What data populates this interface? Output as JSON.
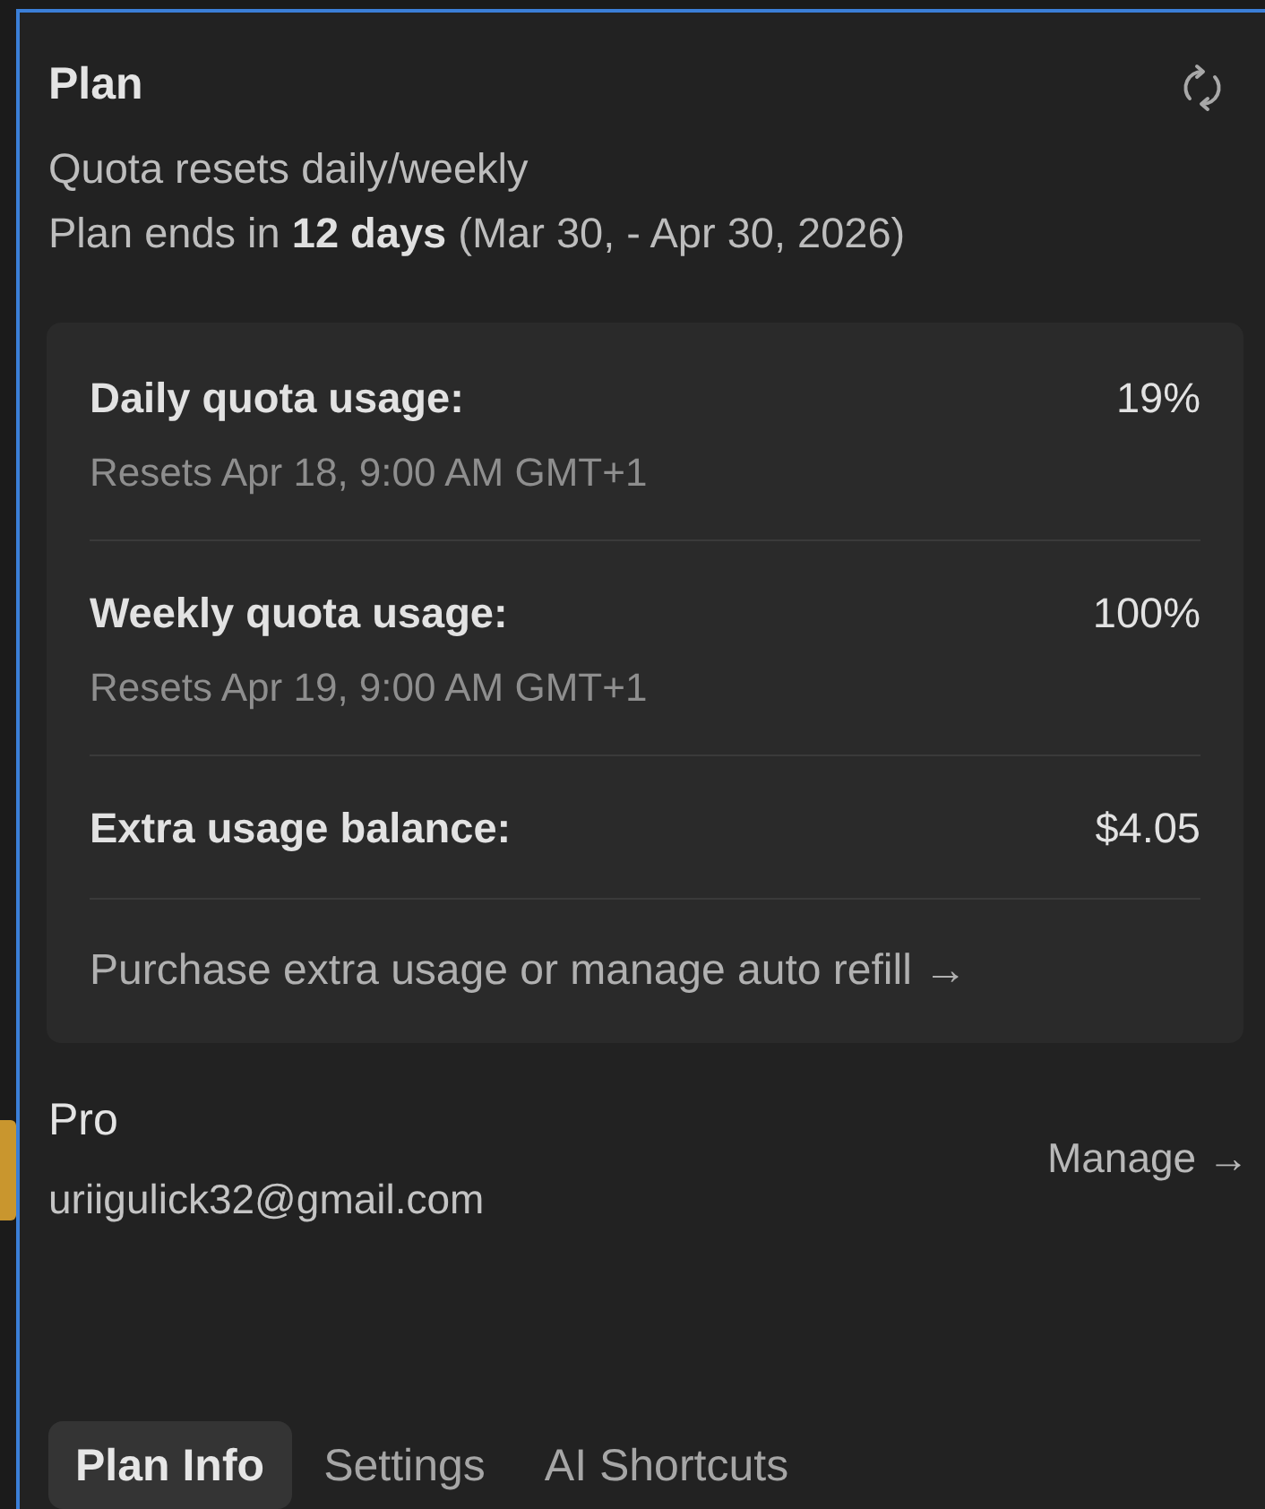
{
  "panel": {
    "title": "Plan",
    "subtitle_lines": [
      "Quota resets daily/weekly",
      "Plan ends in **12 days** (Mar 30, - Apr 30, 2026)"
    ]
  },
  "usage_card": {
    "rows": [
      {
        "label": "Daily quota usage:",
        "value": "19%",
        "note": "Resets Apr 18, 9:00 AM GMT+1"
      },
      {
        "label": "Weekly quota usage:",
        "value": "100%",
        "note": "Resets Apr 19, 9:00 AM GMT+1"
      },
      {
        "label": "Extra usage balance:",
        "value": "$4.05"
      }
    ],
    "link": "Purchase extra usage or manage auto refill →"
  },
  "account": {
    "plan": "Pro",
    "email": "uriigulick32@gmail.com",
    "manage_link": "Manage →"
  },
  "tabs": [
    {
      "label": "Plan Info",
      "selected": true
    },
    {
      "label": "Settings",
      "selected": false
    },
    {
      "label": "AI Shortcuts",
      "selected": false
    }
  ]
}
